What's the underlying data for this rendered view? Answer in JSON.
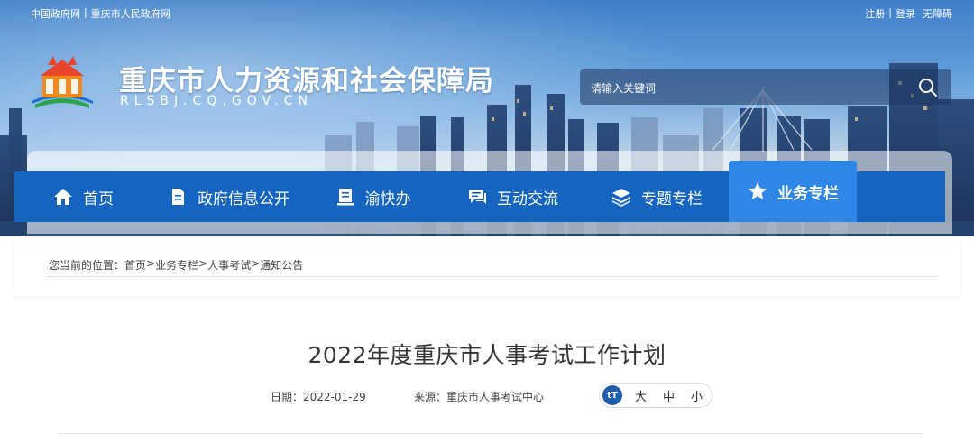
{
  "top_links": {
    "left": [
      "中国政府网",
      "重庆市人民政府网"
    ],
    "separator": "|",
    "right": [
      "注册",
      "登录",
      "无障碍"
    ]
  },
  "header": {
    "title": "重庆市人力资源和社会保障局",
    "url": "RLSBJ.CQ.GOV.CN"
  },
  "search": {
    "placeholder": "请输入关键词"
  },
  "nav": {
    "items": [
      {
        "label": "首页",
        "icon": "home-icon"
      },
      {
        "label": "政府信息公开",
        "icon": "document-icon"
      },
      {
        "label": "渝快办",
        "icon": "badge-icon"
      },
      {
        "label": "互动交流",
        "icon": "chat-icon"
      },
      {
        "label": "专题专栏",
        "icon": "layers-icon"
      },
      {
        "label": "业务专栏",
        "icon": "star-icon"
      }
    ],
    "active": "业务专栏"
  },
  "breadcrumb": {
    "prefix": "您当前的位置：",
    "items": [
      "首页",
      "业务专栏",
      "人事考试",
      "通知公告"
    ],
    "separator": ">"
  },
  "article": {
    "title": "2022年度重庆市人事考试工作计划",
    "date_label": "日期：2022-01-29",
    "source_label": "来源：重庆市人事考试中心",
    "font_sizes": {
      "icon_text": "tT",
      "large": "大",
      "medium": "中",
      "small": "小"
    }
  },
  "colors": {
    "nav_bg": "#1565c0",
    "nav_active": "#2e86e6",
    "accent": "#1f5eaa"
  }
}
